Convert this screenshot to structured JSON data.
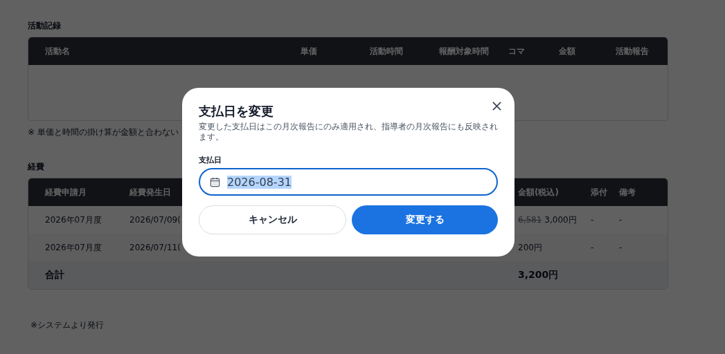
{
  "activity_section": {
    "title": "活動記録",
    "columns": [
      "活動名",
      "単価",
      "活動時間",
      "報酬対象時間",
      "コマ",
      "金額",
      "活動報告"
    ],
    "note": "※ 単価と時間の掛け算が金額と合わない"
  },
  "expense_section": {
    "title": "経費",
    "columns": [
      "経費申請月",
      "経費発生日",
      "金額(税込)",
      "添付",
      "備考"
    ],
    "rows": [
      {
        "month": "2026年07月度",
        "date": "2026/07/09(",
        "amount_original": "6,581",
        "amount": "3,000円",
        "attachment": "-",
        "remarks": "-"
      },
      {
        "month": "2026年07月度",
        "date": "2026/07/11(",
        "amount": "200円",
        "attachment": "-",
        "remarks": "-"
      }
    ],
    "total": {
      "label": "合計",
      "amount": "3,200円"
    }
  },
  "footer_note": "※システムより発行",
  "dialog": {
    "title": "支払日を変更",
    "description": "変更した支払日はこの月次報告にのみ適用され、指導者の月次報告にも反映されます。",
    "field_label": "支払日",
    "value": "2026-08-31",
    "value_selected": true,
    "focused": true,
    "buttons": [
      {
        "label": "キャンセル",
        "kind": "secondary"
      },
      {
        "label": "変更する",
        "kind": "primary"
      }
    ]
  }
}
